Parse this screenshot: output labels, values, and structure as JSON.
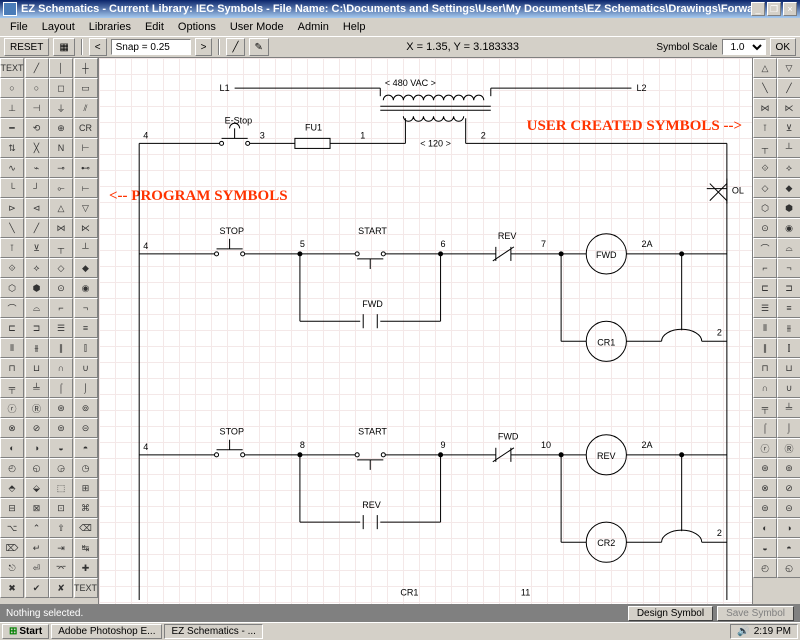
{
  "title": "EZ Schematics - Current Library: IEC Symbols - File Name: C:\\Documents and Settings\\User\\My Documents\\EZ Schematics\\Drawings\\Forward_Reverse.els",
  "menu": {
    "items": [
      "File",
      "Layout",
      "Libraries",
      "Edit",
      "Options",
      "User Mode",
      "Admin",
      "Help"
    ]
  },
  "toolbar": {
    "reset": "RESET",
    "snap_label": "Snap = 0.25",
    "coord": "X = 1.35, Y = 3.183333",
    "scale_label": "Symbol Scale",
    "scale_value": "1.00",
    "ok": "OK"
  },
  "annotations": {
    "left": "<-- PROGRAM SYMBOLS",
    "right": "USER CREATED SYMBOLS -->"
  },
  "schematic": {
    "L1": "L1",
    "L2": "L2",
    "vac480": "< 480 VAC >",
    "vac120": "< 120 >",
    "estop": "E-Stop",
    "fu1": "FU1",
    "n1": "1",
    "n2": "2",
    "n2a": "2",
    "n2b": "2",
    "n3": "3",
    "n4": "4",
    "n4a": "4",
    "n4b": "4",
    "n5": "5",
    "n6": "6",
    "n7": "7",
    "n8": "8",
    "n9": "9",
    "n10": "10",
    "n11": "11",
    "a2a": "2A",
    "a2b": "2A",
    "stop1": "STOP",
    "stop2": "STOP",
    "start1": "START",
    "start2": "START",
    "fwd": "FWD",
    "fwd_contact": "FWD",
    "fwd_contact2": "FWD",
    "rev": "REV",
    "rev_contact": "REV",
    "rev_contact2": "REV",
    "cr1": "CR1",
    "cr2": "CR2",
    "cr1_contact": "CR1",
    "ol": "OL"
  },
  "status": {
    "text": "Nothing selected.",
    "design_symbol": "Design Symbol",
    "save_symbol": "Save Symbol"
  },
  "taskbar": {
    "start": "Start",
    "tasks": [
      "Adobe Photoshop E...",
      "EZ Schematics - ..."
    ],
    "time": "2:19 PM"
  },
  "palette_left_count": 108,
  "palette_right_count": 52
}
